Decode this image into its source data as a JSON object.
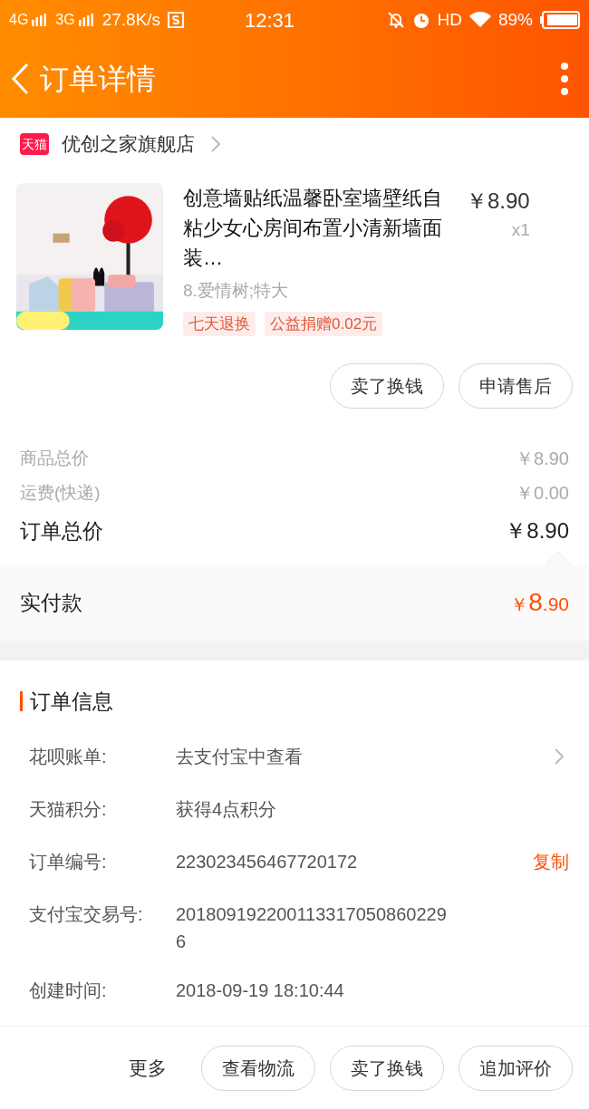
{
  "status_bar": {
    "network_1": "4G",
    "network_2": "3G",
    "speed": "27.8K/s",
    "time": "12:31",
    "hd": "HD",
    "battery": "89%"
  },
  "header": {
    "title": "订单详情"
  },
  "store": {
    "badge": "天猫",
    "name": "优创之家旗舰店"
  },
  "product": {
    "title": "创意墙贴纸温馨卧室墙壁纸自粘少女心房间布置小清新墙面装…",
    "price": "￥8.90",
    "quantity": "x1",
    "variant": "8.爱情树;特大",
    "tags": [
      "七天退换",
      "公益捐赠0.02元"
    ],
    "image": {
      "kind": "picture"
    }
  },
  "product_actions": [
    "卖了换钱",
    "申请售后"
  ],
  "price_rows": [
    {
      "label": "商品总价",
      "value": "￥8.90",
      "kind": "minor"
    },
    {
      "label": "运费(快递)",
      "value": "￥0.00",
      "kind": "minor"
    },
    {
      "label": "订单总价",
      "value": "￥8.90",
      "kind": "major"
    }
  ],
  "paid": {
    "label": "实付款",
    "currency": "￥",
    "integer": "8",
    "decimal": ".90"
  },
  "order_info": {
    "title": "订单信息",
    "rows": [
      {
        "label": "花呗账单:",
        "value": "去支付宝中查看",
        "kind": "link"
      },
      {
        "label": "天猫积分:",
        "value": "获得4点积分",
        "kind": "plain"
      },
      {
        "label": "订单编号:",
        "value": "223023456467720172",
        "kind": "copy",
        "action": "复制"
      },
      {
        "label": "支付宝交易号:",
        "value": "2018091922001133170508602296",
        "kind": "plain"
      },
      {
        "label": "创建时间:",
        "value": "2018-09-19 18:10:44",
        "kind": "plain"
      }
    ]
  },
  "bottom_bar": {
    "more": "更多",
    "buttons": [
      "查看物流",
      "卖了换钱",
      "追加评价"
    ]
  }
}
